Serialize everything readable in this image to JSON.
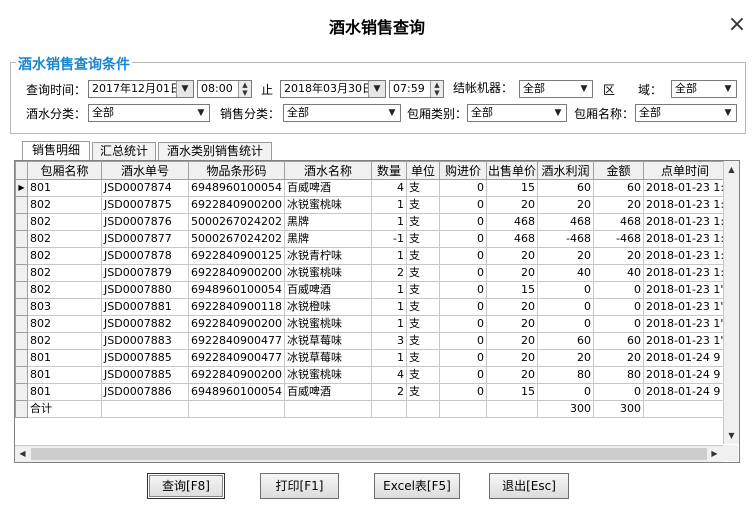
{
  "window": {
    "title": "酒水销售查询",
    "close_icon": "×"
  },
  "filters": {
    "group_title": "酒水销售查询条件",
    "query_time_label": "查询时间：",
    "start_date": "2017年12月01日",
    "start_time": "08:00",
    "to_label": "止",
    "end_date": "2018年03月30日",
    "end_time": "07:59",
    "machine_label": "结帐机器：",
    "machine_value": "全部",
    "area_label": "区",
    "domain_label": "域：",
    "area_value": "全部",
    "drink_category_label": "酒水分类：",
    "drink_category_value": "全部",
    "sales_category_label": "销售分类：",
    "sales_category_value": "全部",
    "room_type_label": "包厢类别：",
    "room_type_value": "全部",
    "room_name_label": "包厢名称：",
    "room_name_value": "全部"
  },
  "tabs": [
    "销售明细",
    "汇总统计",
    "酒水类别销售统计"
  ],
  "table": {
    "columns": [
      "包厢名称",
      "酒水单号",
      "物品条形码",
      "酒水名称",
      "数量",
      "单位",
      "购进价",
      "出售单价",
      "酒水利润",
      "金额",
      "点单时间"
    ],
    "rows": [
      [
        "801",
        "JSD0007874",
        "6948960100054",
        "百威啤酒",
        "4",
        "支",
        "0",
        "15",
        "60",
        "60",
        "2018-01-23 1:"
      ],
      [
        "802",
        "JSD0007875",
        "6922840900200",
        "冰锐蜜桃味",
        "1",
        "支",
        "0",
        "20",
        "20",
        "20",
        "2018-01-23 1:"
      ],
      [
        "802",
        "JSD0007876",
        "5000267024202",
        "黑牌",
        "1",
        "支",
        "0",
        "468",
        "468",
        "468",
        "2018-01-23 1:"
      ],
      [
        "802",
        "JSD0007877",
        "5000267024202",
        "黑牌",
        "-1",
        "支",
        "0",
        "468",
        "-468",
        "-468",
        "2018-01-23 1:"
      ],
      [
        "802",
        "JSD0007878",
        "6922840900125",
        "冰锐青柠味",
        "1",
        "支",
        "0",
        "20",
        "20",
        "20",
        "2018-01-23 1:"
      ],
      [
        "802",
        "JSD0007879",
        "6922840900200",
        "冰锐蜜桃味",
        "2",
        "支",
        "0",
        "20",
        "40",
        "40",
        "2018-01-23 1:"
      ],
      [
        "802",
        "JSD0007880",
        "6948960100054",
        "百威啤酒",
        "1",
        "支",
        "0",
        "15",
        "0",
        "0",
        "2018-01-23 1'"
      ],
      [
        "803",
        "JSD0007881",
        "6922840900118",
        "冰锐橙味",
        "1",
        "支",
        "0",
        "20",
        "0",
        "0",
        "2018-01-23 1'"
      ],
      [
        "802",
        "JSD0007882",
        "6922840900200",
        "冰锐蜜桃味",
        "1",
        "支",
        "0",
        "20",
        "0",
        "0",
        "2018-01-23 1'"
      ],
      [
        "802",
        "JSD0007883",
        "6922840900477",
        "冰锐草莓味",
        "3",
        "支",
        "0",
        "20",
        "60",
        "60",
        "2018-01-23 1'"
      ],
      [
        "801",
        "JSD0007885",
        "6922840900477",
        "冰锐草莓味",
        "1",
        "支",
        "0",
        "20",
        "20",
        "20",
        "2018-01-24 9"
      ],
      [
        "801",
        "JSD0007885",
        "6922840900200",
        "冰锐蜜桃味",
        "4",
        "支",
        "0",
        "20",
        "80",
        "80",
        "2018-01-24 9"
      ],
      [
        "801",
        "JSD0007886",
        "6948960100054",
        "百威啤酒",
        "2",
        "支",
        "0",
        "15",
        "0",
        "0",
        "2018-01-24 9"
      ]
    ],
    "total_row": [
      "合计",
      "",
      "",
      "",
      "",
      "",
      "",
      "",
      "300",
      "300",
      ""
    ]
  },
  "buttons": {
    "query": "查询[F8]",
    "print": "打印[F1]",
    "excel": "Excel表[F5]",
    "exit": "退出[Esc]"
  }
}
